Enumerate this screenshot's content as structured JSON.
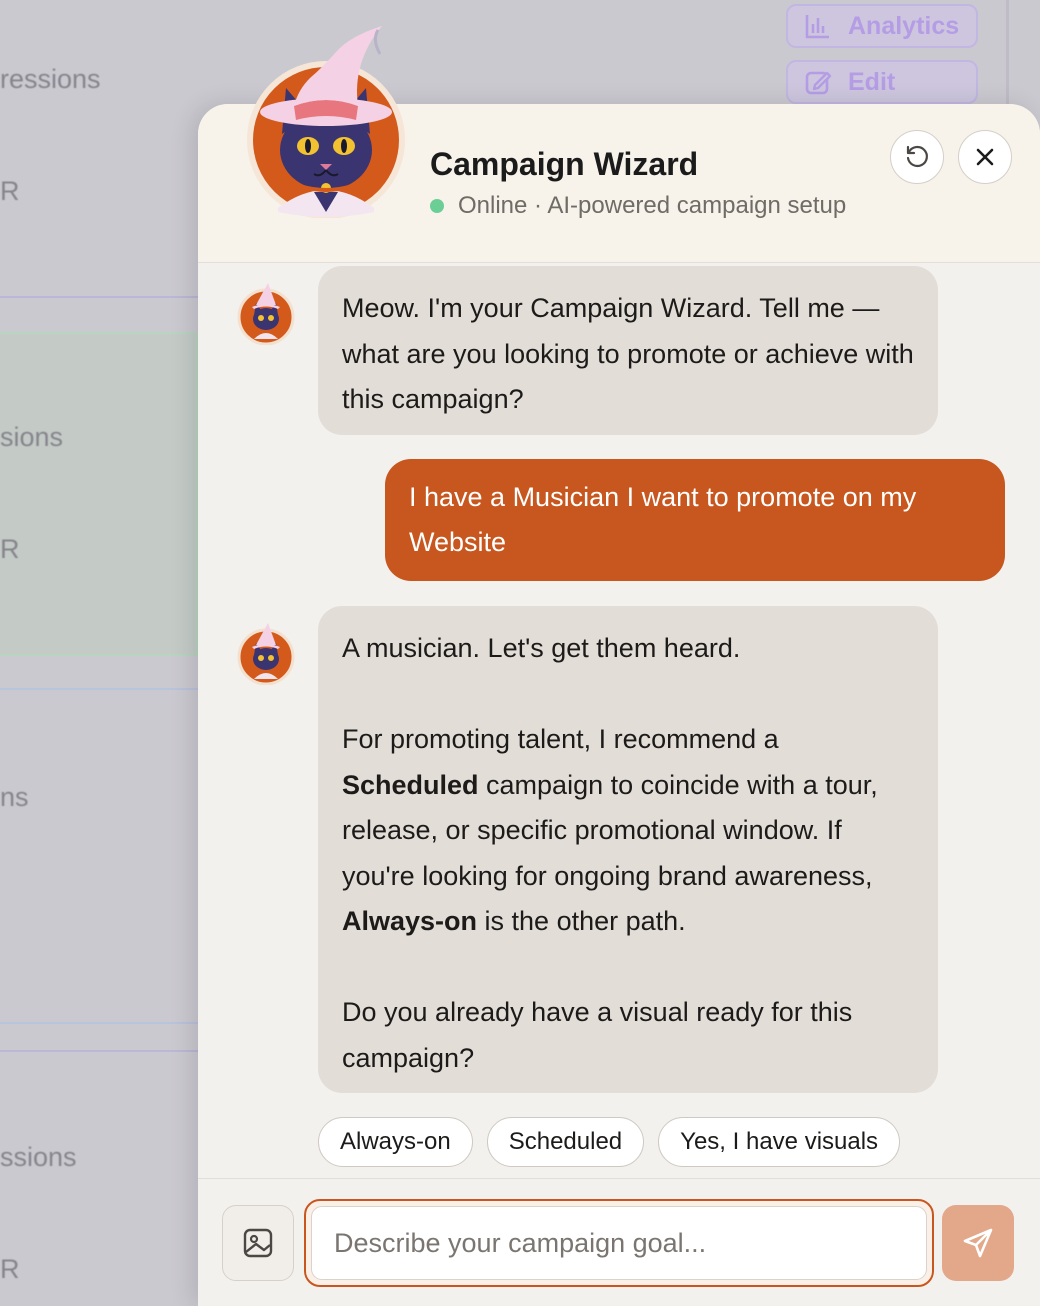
{
  "background": {
    "texts": [
      "ressions",
      "R",
      "sions",
      "R",
      "ns",
      "ssions",
      "R"
    ],
    "buttons": [
      {
        "label": "Analytics",
        "icon": "bar-chart-icon"
      },
      {
        "label": "Edit",
        "icon": "edit-icon"
      }
    ]
  },
  "header": {
    "title": "Campaign Wizard",
    "status": "Online · AI-powered campaign setup",
    "refresh_icon": "refresh-icon",
    "close_icon": "close-icon"
  },
  "messages": [
    {
      "role": "assistant",
      "paragraphs": [
        "Meow. I'm your Campaign Wizard. Tell me — what are you looking to promote or achieve with this campaign?"
      ]
    },
    {
      "role": "user",
      "text": "I have a Musician I want to promote on my Website"
    },
    {
      "role": "assistant",
      "paragraphs": [
        "A musician. Let's get them heard.",
        "For promoting talent, I recommend a Scheduled campaign to coincide with a tour, release, or specific promotional window. If you're looking for ongoing brand awareness, Always-on is the other path.",
        "Do you already have a visual ready for this campaign?"
      ],
      "p2_parts": [
        "For promoting talent, I recommend a ",
        "Scheduled",
        " campaign to coincide with a tour, release, or specific promotional window. If you're looking for ongoing brand awareness, ",
        "Always-on",
        " is the other path."
      ]
    }
  ],
  "quick_replies": [
    "Always-on",
    "Scheduled",
    "Yes, I have visuals"
  ],
  "composer": {
    "placeholder": "Describe your campaign goal...",
    "image_icon": "image-icon",
    "send_icon": "send-icon"
  },
  "colors": {
    "accent": "#c8571f",
    "online": "#6bcf95",
    "bot_bubble": "#e2ddd7"
  }
}
